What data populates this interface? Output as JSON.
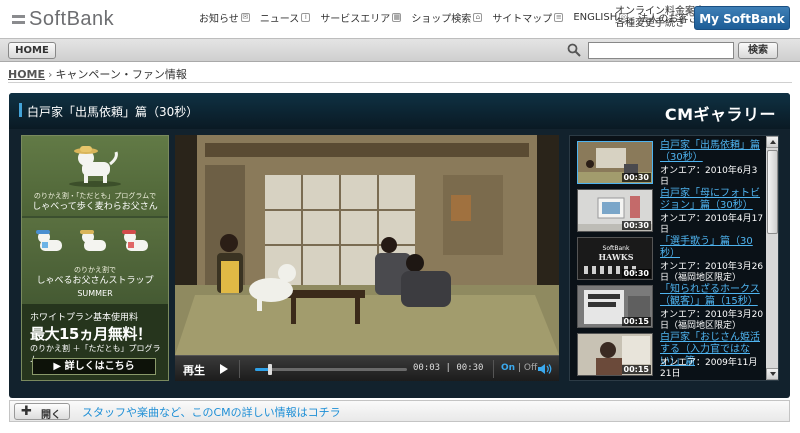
{
  "header": {
    "logo_text": "SoftBank",
    "nav": [
      {
        "label": "お知らせ",
        "icon": "mail-icon"
      },
      {
        "label": "ニュース",
        "icon": "info-icon"
      },
      {
        "label": "サービスエリア",
        "icon": "map-icon"
      },
      {
        "label": "ショップ検索",
        "icon": "shop-icon"
      },
      {
        "label": "サイトマップ",
        "icon": "sitemap-icon"
      },
      {
        "label": "ENGLISH",
        "icon": "globe-icon"
      },
      {
        "label": "法人のお客さま",
        "icon": "building-icon"
      }
    ],
    "online_line1": "オンライン料金案内",
    "online_line2": "各種変更手続き",
    "mysoftbank_label": "My SoftBank"
  },
  "toolbar": {
    "home_label": "HOME",
    "search_placeholder": "",
    "search_button": "検索"
  },
  "breadcrumb": {
    "home": "HOME",
    "separator": "›",
    "current": "キャンペーン・ファン情報"
  },
  "gallery": {
    "video_title": "白戸家「出馬依頼」篇（30秒）",
    "section_label": "CMギャラリー",
    "colors": {
      "accent": "#44a3d8",
      "link": "#4fb4f0",
      "progress": "#2ea1e8"
    }
  },
  "ad": {
    "line1_small": "のりかえ割・「ただとも」プログラムで",
    "line1": "しゃべって歩く麦わらお父さん",
    "line2_small": "のりかえ割で",
    "line2a": "しゃべるお父さんストラップ",
    "line2b": "SUMMER",
    "plan_label": "ホワイトプラン基本使用料",
    "free_text": "最大15ヵ月無料！",
    "program_text": "のりかえ割 ＋「ただとも」プログラム",
    "detail_button": "▶ 詳しくはこちら"
  },
  "player": {
    "play_label": "再生",
    "progress_fraction": 0.1,
    "current_time": "00:03",
    "time_separator": "|",
    "total_time": "00:30",
    "on_label": "On",
    "off_separator": "|",
    "off_label": "Off"
  },
  "playlist": [
    {
      "title": "白戸家「出馬依頼」篇（30秒）",
      "meta": "オンエア：2010年6月3日",
      "duration": "00:30",
      "active": true
    },
    {
      "title": "白戸家「母にフォトビジョン」篇（30秒）",
      "meta": "オンエア：2010年4月17日",
      "duration": "00:30",
      "active": false
    },
    {
      "title": "「選手歌う」篇（30秒）",
      "meta": "オンエア：2010年3月26日（福岡地区限定）",
      "duration": "00:30",
      "active": false
    },
    {
      "title": "「知られざるホークス（観客）」篇（15秒）",
      "meta": "オンエア：2010年3月20日（福岡地区限定）",
      "duration": "00:15",
      "active": false
    },
    {
      "title": "白戸家「おじさん姫活する（入力官ではない）」篇",
      "meta": "オンエア：2009年11月21日",
      "duration": "00:15",
      "active": false
    }
  ],
  "infobar": {
    "open_label": "開く",
    "link_text": "スタッフや楽曲など、このCMの詳しい情報はコチラ"
  }
}
